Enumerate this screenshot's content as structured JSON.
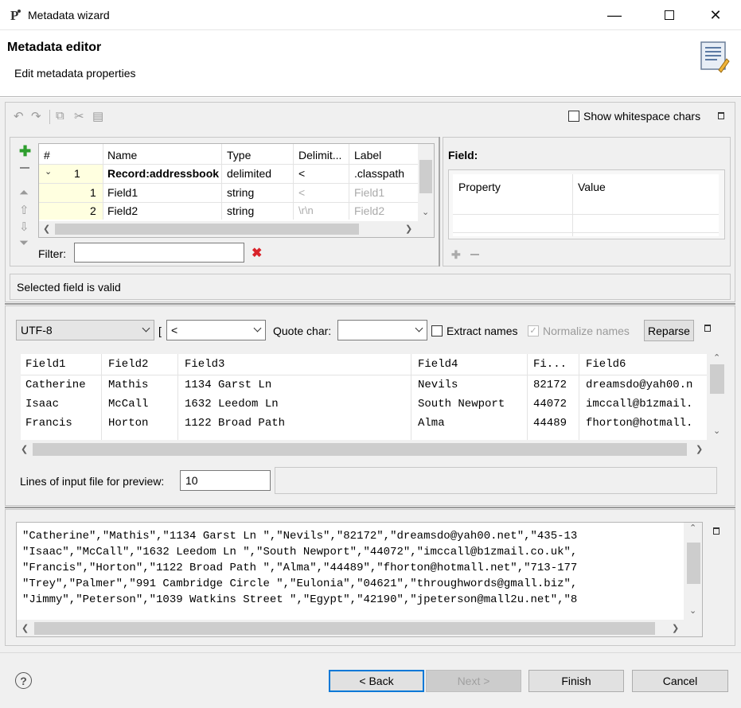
{
  "window": {
    "title": "Metadata wizard"
  },
  "header": {
    "title": "Metadata editor",
    "subtitle": "Edit metadata properties"
  },
  "toolbar": {
    "show_whitespace": "Show whitespace chars"
  },
  "grid": {
    "columns": [
      "#",
      "Name",
      "Type",
      "Delimit...",
      "Label"
    ],
    "rows": [
      {
        "num": "1",
        "name": "Record:addressbook",
        "type": "delimited",
        "delim": "<",
        "label": ".classpath"
      },
      {
        "num": "1",
        "name": "Field1",
        "type": "string",
        "delim": "<",
        "label": "Field1"
      },
      {
        "num": "2",
        "name": "Field2",
        "type": "string",
        "delim": "\\r\\n",
        "label": "Field2"
      }
    ]
  },
  "filter": {
    "label": "Filter:",
    "value": ""
  },
  "field_panel": {
    "title": "Field:",
    "columns": [
      "Property",
      "Value"
    ]
  },
  "status": "Selected field is valid",
  "parser": {
    "encoding": "UTF-8",
    "delimiter_short": "[",
    "delimiter": "<",
    "quote_label": "Quote char:",
    "quote_value": "",
    "extract_names": "Extract names",
    "normalize_names": "Normalize names",
    "reparse": "Reparse"
  },
  "preview": {
    "columns": [
      "Field1",
      "Field2",
      "Field3",
      "Field4",
      "Fi...",
      "Field6"
    ],
    "rows": [
      [
        "Catherine",
        "Mathis",
        "1134 Garst Ln",
        "Nevils",
        "82172",
        "dreamsdo@yah00.n"
      ],
      [
        "Isaac",
        "McCall",
        "1632 Leedom Ln",
        "South Newport",
        "44072",
        "imccall@b1zmail."
      ],
      [
        "Francis",
        "Horton",
        "1122 Broad Path",
        "Alma",
        "44489",
        "fhorton@hotmall."
      ]
    ]
  },
  "lines": {
    "label": "Lines of input file for preview:",
    "value": "10"
  },
  "raw": [
    "\"Catherine\",\"Mathis\",\"1134 Garst Ln \",\"Nevils\",\"82172\",\"dreamsdo@yah00.net\",\"435-13",
    "\"Isaac\",\"McCall\",\"1632 Leedom Ln \",\"South Newport\",\"44072\",\"imccall@b1zmail.co.uk\",",
    "\"Francis\",\"Horton\",\"1122 Broad Path \",\"Alma\",\"44489\",\"fhorton@hotmall.net\",\"713-177",
    "\"Trey\",\"Palmer\",\"991 Cambridge Circle \",\"Eulonia\",\"04621\",\"throughwords@gmall.biz\",",
    "\"Jimmy\",\"Peterson\",\"1039 Watkins Street \",\"Egypt\",\"42190\",\"jpeterson@mall2u.net\",\"8"
  ],
  "footer": {
    "back": "< Back",
    "next": "Next >",
    "finish": "Finish",
    "cancel": "Cancel"
  },
  "colors": {
    "accent": "#0078d7",
    "highlight_row": "#ffffe0",
    "error": "#d9232a",
    "add_green": "#2e9e2e"
  }
}
